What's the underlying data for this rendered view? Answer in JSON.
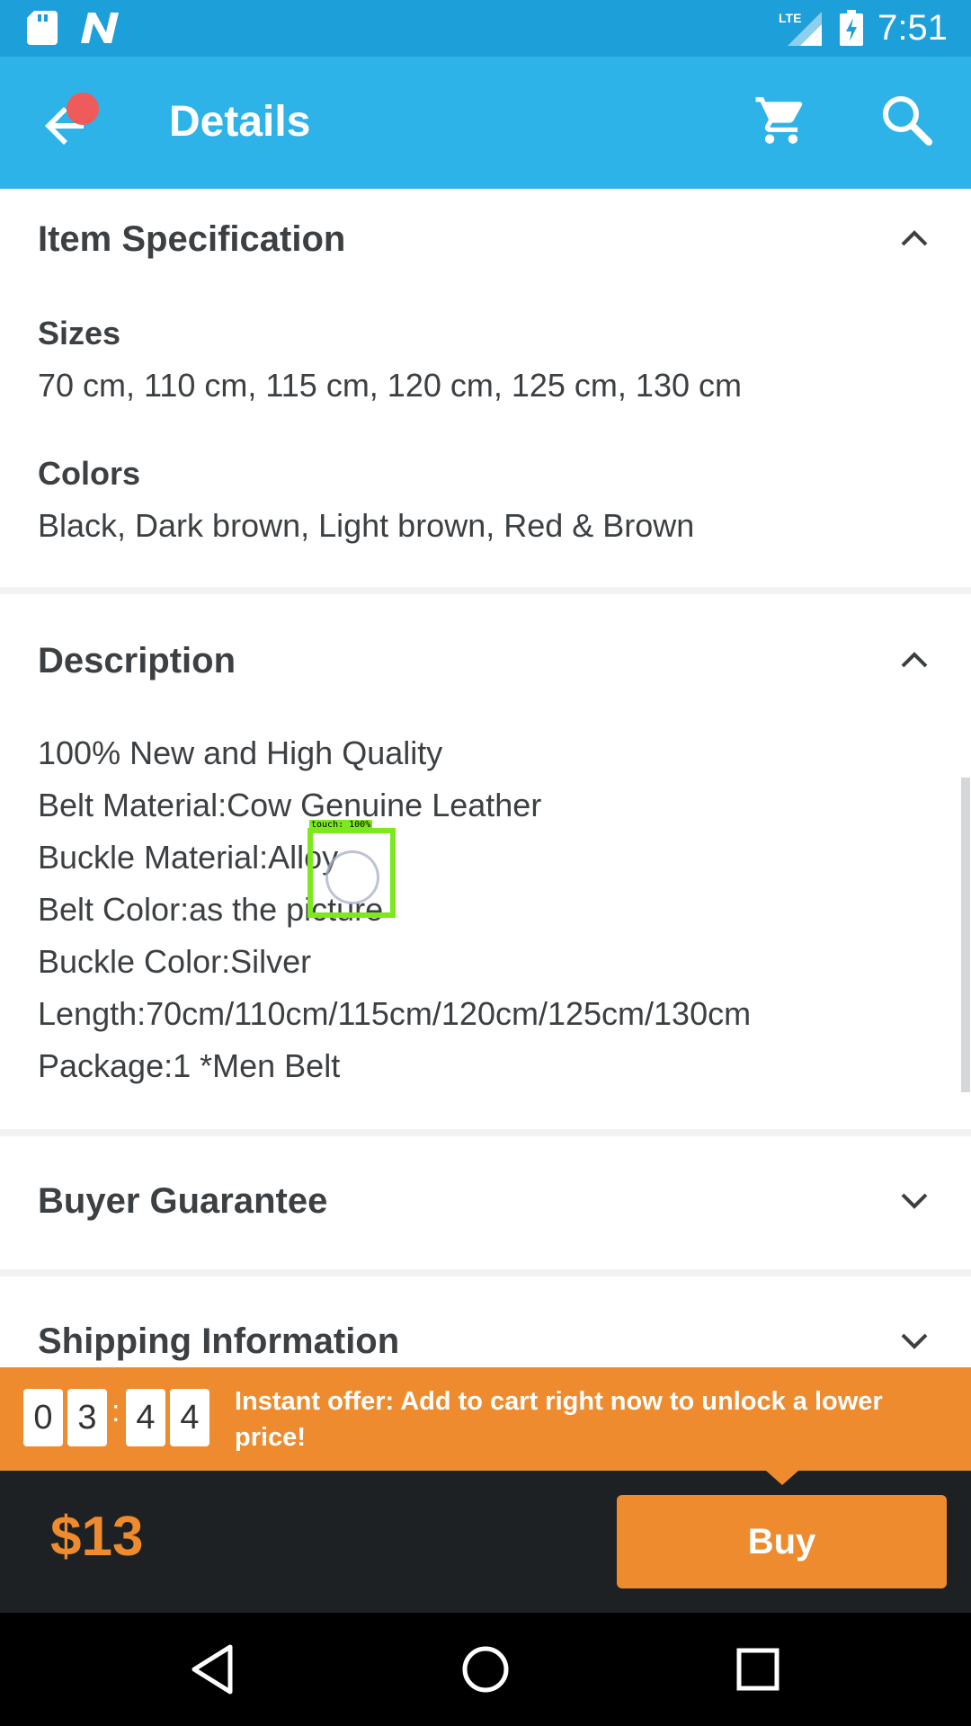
{
  "status_bar": {
    "time": "7:51",
    "network": "LTE",
    "icons": [
      "sd-card-icon",
      "n-logo-icon",
      "lte-signal-icon",
      "battery-charging-icon"
    ]
  },
  "app_bar": {
    "title": "Details",
    "icons": [
      "back-arrow-icon",
      "cart-icon",
      "search-icon"
    ],
    "notification_color": "#ef5b5b"
  },
  "item_specification": {
    "title": "Item Specification",
    "expanded": true,
    "sizes_label": "Sizes",
    "sizes_value": "70 cm, 110 cm, 115 cm, 120 cm, 125 cm, 130 cm",
    "colors_label": "Colors",
    "colors_value": "Black, Dark brown, Light brown, Red & Brown"
  },
  "description": {
    "title": "Description",
    "expanded": true,
    "lines": [
      "100% New and High Quality",
      "Belt Material:Cow Genuine Leather",
      "Buckle Material:Alloy",
      "Belt Color:as the picture",
      "Buckle Color:Silver",
      "Length:70cm/110cm/115cm/120cm/125cm/130cm",
      "Package:1 *Men Belt"
    ]
  },
  "buyer_guarantee": {
    "title": "Buyer Guarantee",
    "expanded": false
  },
  "shipping_information": {
    "title": "Shipping Information",
    "expanded": false
  },
  "touch_overlay": {
    "label": "touch: 100%"
  },
  "offer": {
    "countdown_digits": [
      "0",
      "3",
      "4",
      "4"
    ],
    "separator": ":",
    "text": "Instant offer: Add to cart right now to unlock a lower price!"
  },
  "bottom_bar": {
    "price": "$13",
    "buy_label": "Buy"
  },
  "colors": {
    "status_bar": "#1d9fd9",
    "app_bar": "#2db3e8",
    "accent_orange": "#ee8b2e",
    "bottom_bar": "#1e2123",
    "text": "#3c4043"
  }
}
